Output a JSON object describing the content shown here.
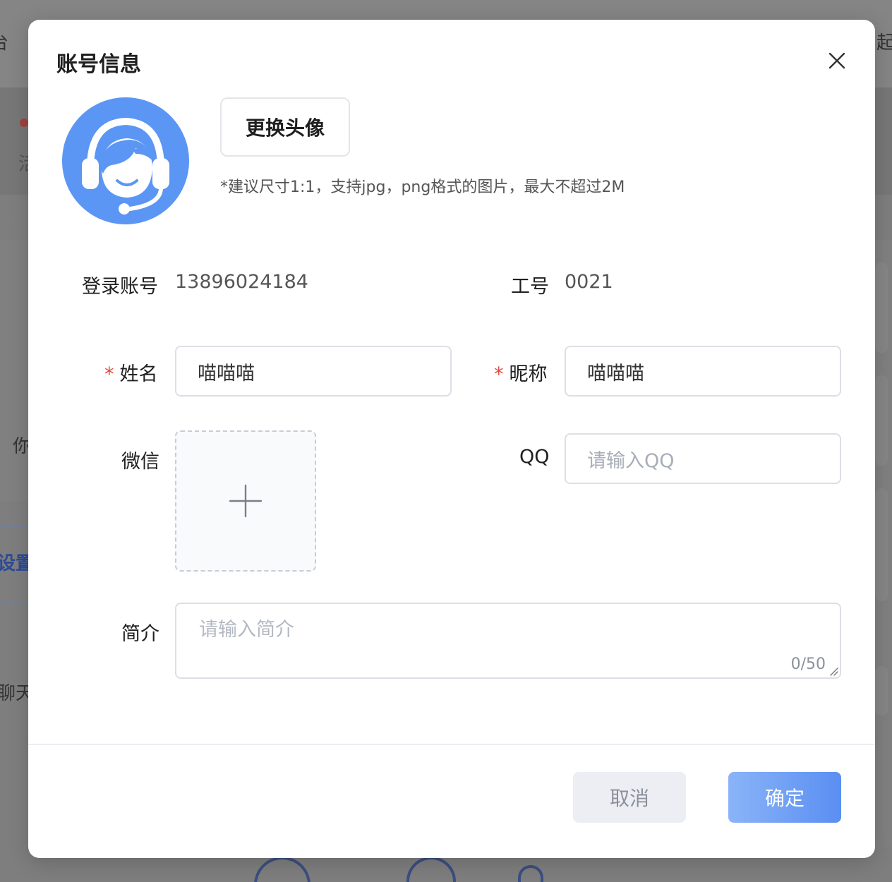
{
  "background": {
    "fragments": [
      "台",
      "起",
      "活",
      "你",
      "设置",
      "聊天"
    ]
  },
  "dialog": {
    "title": "账号信息",
    "avatar_button": "更换头像",
    "avatar_hint": "*建议尺寸1:1，支持jpg，png格式的图片，最大不超过2M",
    "login_account_label": "登录账号",
    "login_account_value": "13896024184",
    "employee_no_label": "工号",
    "employee_no_value": "0021",
    "required_mark": "*",
    "name_label": "姓名",
    "name_value": "喵喵喵",
    "nickname_label": "昵称",
    "nickname_value": "喵喵喵",
    "wechat_label": "微信",
    "qq_label": "QQ",
    "qq_placeholder": "请输入QQ",
    "intro_label": "简介",
    "intro_placeholder": "请输入简介",
    "intro_count": "0/50",
    "cancel_button": "取消",
    "confirm_button": "确定"
  },
  "colors": {
    "accent": "#5a8ef2",
    "avatar_bg": "#5b96f4",
    "required": "#e5483a"
  }
}
